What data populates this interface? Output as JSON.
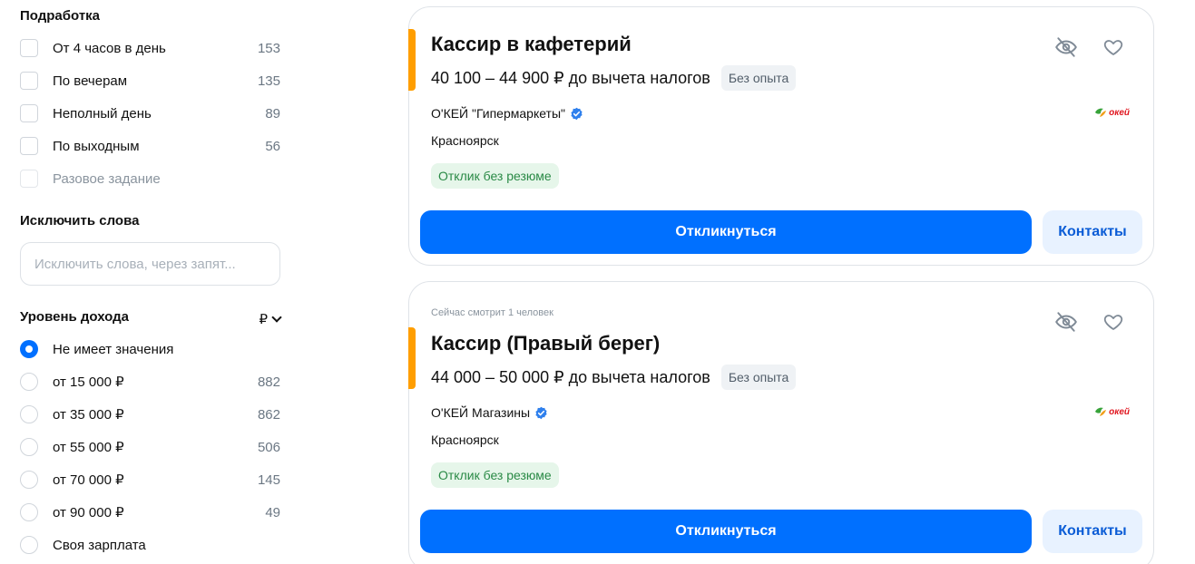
{
  "sidebar": {
    "part_time": {
      "title": "Подработка",
      "options": [
        {
          "label": "От 4 часов в день",
          "count": "153"
        },
        {
          "label": "По вечерам",
          "count": "135"
        },
        {
          "label": "Неполный день",
          "count": "89"
        },
        {
          "label": "По выходным",
          "count": "56"
        },
        {
          "label": "Разовое задание",
          "count": ""
        }
      ]
    },
    "exclude_words": {
      "title": "Исключить слова",
      "placeholder": "Исключить слова, через запят..."
    },
    "income": {
      "title": "Уровень дохода",
      "currency": "₽",
      "options": [
        {
          "label": "Не имеет значения",
          "count": ""
        },
        {
          "label": "от 15 000 ₽",
          "count": "882"
        },
        {
          "label": "от 35 000 ₽",
          "count": "862"
        },
        {
          "label": "от 55 000 ₽",
          "count": "506"
        },
        {
          "label": "от 70 000 ₽",
          "count": "145"
        },
        {
          "label": "от 90 000 ₽",
          "count": "49"
        },
        {
          "label": "Своя зарплата",
          "count": ""
        }
      ]
    }
  },
  "vacancies": [
    {
      "viewing": "",
      "title": "Кассир в кафетерий",
      "salary": "40 100 – 44 900 ₽ до вычета налогов",
      "experience": "Без опыта",
      "company": "О'КЕЙ \"Гипермаркеты\"",
      "city": "Красноярск",
      "badge": "Отклик без резюме",
      "logo_text": "окей",
      "apply_label": "Откликнуться",
      "contacts_label": "Контакты"
    },
    {
      "viewing": "Сейчас смотрит 1 человек",
      "title": "Кассир (Правый берег)",
      "salary": "44 000 – 50 000 ₽ до вычета налогов",
      "experience": "Без опыта",
      "company": "О'КЕЙ Магазины",
      "city": "Красноярск",
      "badge": "Отклик без резюме",
      "logo_text": "окей",
      "apply_label": "Откликнуться",
      "contacts_label": "Контакты"
    }
  ],
  "colors": {
    "accent_orange": "#ff9e00",
    "primary_blue": "#0070ff",
    "badge_green": "#2a8a46",
    "logo_red": "#e0161f"
  },
  "icons": [
    "hide-icon",
    "heart-icon",
    "verified-icon",
    "chevron-down-icon",
    "okey-logo"
  ]
}
